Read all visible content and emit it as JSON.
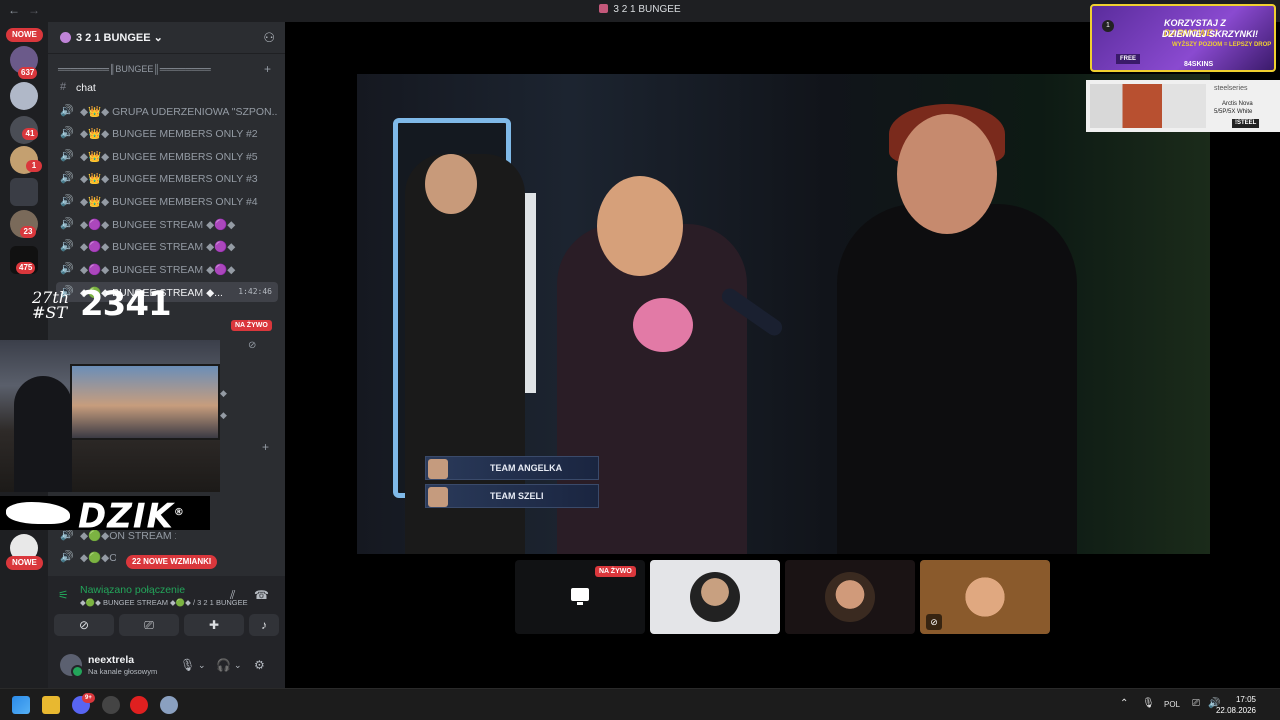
{
  "window": {
    "back_icon": "←",
    "forward_icon": "→",
    "title": "3 2 1 BUNGEE"
  },
  "servers": {
    "new_top": "NOWE",
    "new_bottom": "NOWE",
    "badges": [
      "637",
      "41",
      "1",
      "23",
      "475"
    ]
  },
  "server_header": {
    "name": "3 2 1 BUNGEE",
    "chevron": "⌄"
  },
  "category": {
    "label": "════════║BUNGEE║════════"
  },
  "channels": [
    {
      "label": "chat",
      "type": "text"
    },
    {
      "label": "◆👑◆ GRUPA UDERZENIOWA \"SZPON...",
      "type": "voice"
    },
    {
      "label": "◆👑◆ BUNGEE MEMBERS ONLY #2",
      "type": "voice"
    },
    {
      "label": "◆👑◆ BUNGEE MEMBERS ONLY #5",
      "type": "voice"
    },
    {
      "label": "◆👑◆ BUNGEE MEMBERS ONLY #3",
      "type": "voice"
    },
    {
      "label": "◆👑◆ BUNGEE MEMBERS ONLY #4",
      "type": "voice"
    },
    {
      "label": "◆🟣◆ BUNGEE STREAM ◆🟣◆",
      "type": "voice"
    },
    {
      "label": "◆🟣◆ BUNGEE STREAM ◆🟣◆",
      "type": "voice"
    },
    {
      "label": "◆🟣◆ BUNGEE STREAM ◆🟣◆",
      "type": "voice"
    },
    {
      "label": "◆🟢◆ BUNGEE STREAM ◆...",
      "type": "voice",
      "active": true,
      "duration": "1:42:46"
    }
  ],
  "partial_channels": [
    {
      "label": "◆🟢◆ON STREAM 1"
    },
    {
      "label": "◆🟢◆ON"
    }
  ],
  "overlay": {
    "big_number": "2341",
    "small_text": "27th",
    "small_text_2": "#ST",
    "brand": "DZIK",
    "brand_mark": "®"
  },
  "live_label": "NA ŻYWO",
  "mentions_pill": "22 NOWE WZMIANKI",
  "voice_panel": {
    "status": "Nawiązano połączenie",
    "location": "◆🟢◆ BUNGEE STREAM ◆🟢◆ / 3 2 1 BUNGEE"
  },
  "user_panel": {
    "username": "neextrela",
    "status": "Na kanale głosowym"
  },
  "video": {
    "teams": [
      "TEAM ANGELKA",
      "TEAM SZELI"
    ]
  },
  "tiles": {
    "live": "NA ŻYWO"
  },
  "ads": {
    "line1a": "KORZYSTAJ Z ",
    "line1b": "DARMOWEJ",
    "line2": "DZIENNEJ SKRZYNKI!",
    "line3": "WYŻSZY POZIOM = LEPSZY DROP",
    "free": "FREE",
    "brand1": "84SKINS",
    "counter": "1",
    "brand2": "steelseries",
    "product1": "Arctis Nova",
    "product2": "5/5P/5X White",
    "command": "!STEEL"
  },
  "taskbar": {
    "lang": "POL",
    "time": "17:05",
    "date": "22.08.2026",
    "discord_badge": "9+"
  },
  "colors": {
    "accent_green": "#23a55a",
    "alert_red": "#da373c",
    "sidebar": "#2b2d31",
    "server_rail": "#1e1f22"
  }
}
